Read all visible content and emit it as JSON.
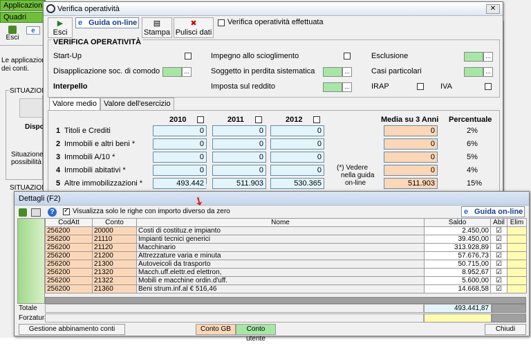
{
  "app": {
    "tabs": [
      "Applicazioni",
      "Quadri"
    ],
    "esci": "Esci",
    "desc_line1": "Le applicazioni",
    "desc_line2": "dei conti.",
    "situazione1": "SITUAZION",
    "dispo": "Dispo",
    "situazione_text1": "Situazione",
    "situazione_text2": "possibilità d",
    "situazione2": "SITUAZION"
  },
  "dialog1": {
    "title": "Verifica operatività",
    "toolbar": {
      "esci": "Esci",
      "guida": "Guida on-line",
      "stampa": "Stampa",
      "pulisci": "Pulisci dati",
      "verifica_label": "Verifica operatività effettuata"
    },
    "section_title": "VERIFICA OPERATIVITÀ",
    "options": {
      "startup": "Start-Up",
      "impegno": "Impegno allo scioglimento",
      "esclusione": "Esclusione",
      "disapplicazione": "Disapplicazione soc. di comodo",
      "soggetto": "Soggetto in perdita sistematica",
      "casi": "Casi particolari",
      "interpello": "Interpello",
      "imposta": "Imposta sul reddito",
      "irap": "IRAP",
      "iva": "IVA"
    },
    "tabs": [
      "Valore medio",
      "Valore dell'esercizio"
    ],
    "columns": {
      "y2010": "2010",
      "y2011": "2011",
      "y2012": "2012",
      "media": "Media su 3 Anni",
      "perc": "Percentuale"
    },
    "rows": [
      {
        "num": "1",
        "label": "Titoli e Crediti",
        "v2010": "0",
        "v2011": "0",
        "v2012": "0",
        "media": "0",
        "perc": "2%"
      },
      {
        "num": "2",
        "label": "Immobili e altri beni *",
        "v2010": "0",
        "v2011": "0",
        "v2012": "0",
        "media": "0",
        "perc": "6%"
      },
      {
        "num": "3",
        "label": "Immobili A/10 *",
        "v2010": "0",
        "v2011": "0",
        "v2012": "0",
        "media": "0",
        "perc": "5%"
      },
      {
        "num": "4",
        "label": "Immobili abitativi *",
        "v2010": "0",
        "v2011": "0",
        "v2012": "0",
        "media": "0",
        "perc": "4%"
      },
      {
        "num": "5",
        "label": "Altre immobilizzazioni *",
        "v2010": "493.442",
        "v2011": "511.903",
        "v2012": "530.365",
        "media": "511.903",
        "perc": "15%"
      }
    ],
    "note_line1": "(*) Vedere",
    "note_line2": "nella guida",
    "note_line3": "on-line"
  },
  "dialog2": {
    "title": "Dettagli (F2)",
    "filter_label": "Visualizza solo le righe con importo diverso da zero",
    "guida": "Guida on-line",
    "headers": {
      "codatt": "CodAtt",
      "conto": "Conto",
      "nome": "Nome",
      "saldo": "Saldo",
      "abil": "Abil",
      "elim": "Elim"
    },
    "rows": [
      {
        "codatt": "256200",
        "conto": "20000",
        "nome": "Costi di costituz.e impianto",
        "saldo": "2.450,00"
      },
      {
        "codatt": "256200",
        "conto": "21110",
        "nome": "Impianti tecnici generici",
        "saldo": "39.450,00"
      },
      {
        "codatt": "256200",
        "conto": "21120",
        "nome": "Macchinario",
        "saldo": "313.928,89"
      },
      {
        "codatt": "256200",
        "conto": "21200",
        "nome": "Attrezzature varia e minuta",
        "saldo": "57.676,73"
      },
      {
        "codatt": "256200",
        "conto": "21300",
        "nome": "Autoveicoli da trasporto",
        "saldo": "50.715,00"
      },
      {
        "codatt": "256200",
        "conto": "21320",
        "nome": "Macch.uff.elettr.ed elettron,",
        "saldo": "8.952,67"
      },
      {
        "codatt": "256200",
        "conto": "21322",
        "nome": "Mobili e macchine ordin.d'uff.",
        "saldo": "5.600,00"
      },
      {
        "codatt": "256200",
        "conto": "21360",
        "nome": "Beni strum.inf.al € 516,46",
        "saldo": "14.668,58"
      }
    ],
    "totale_label": "Totale",
    "totale_value": "493.441,87",
    "forzatura_label": "Forzatura",
    "gestione": "Gestione abbinamento conti",
    "conto_gb": "Conto GB",
    "conto_utente": "Conto utente",
    "chiudi": "Chiudi"
  },
  "colors": {
    "green": "#a8e6a8",
    "orange": "#fbd7b8",
    "light_blue": "#e3f5fb",
    "yellow": "#fffbb0"
  }
}
